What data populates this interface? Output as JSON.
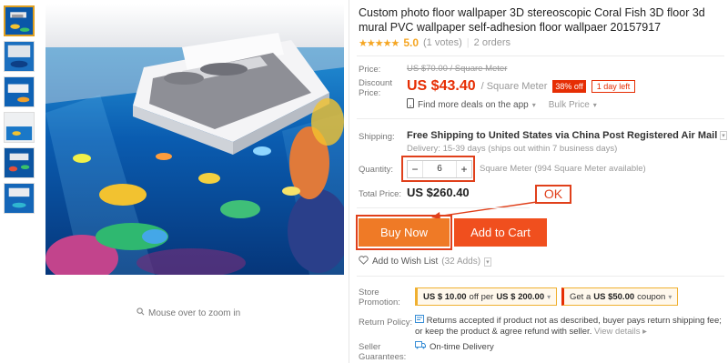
{
  "product": {
    "title": "Custom photo floor wallpaper 3D stereoscopic Coral Fish 3D floor 3d mural PVC wallpaper self-adhesion floor wallpaer 20157917",
    "stars": "★★★★★",
    "rating": "5.0",
    "votes": "(1 votes)",
    "orders": "2 orders"
  },
  "pricing": {
    "price_label": "Price:",
    "original_price": "US $70.00 / Square Meter",
    "discount_label": "Discount Price:",
    "discount_price": "US $43.40",
    "unit": "/ Square Meter",
    "off_badge": "38% off",
    "days_left": "1 day left",
    "app_deals": "Find more deals on the app",
    "bulk_price": "Bulk Price"
  },
  "shipping": {
    "label": "Shipping:",
    "main": "Free Shipping to United States via China Post Registered Air Mail",
    "delivery": "Delivery: 15-39 days (ships out within 7 business days)"
  },
  "quantity": {
    "label": "Quantity:",
    "minus": "−",
    "value": "6",
    "plus": "+",
    "available": "Square Meter (994 Square Meter available)"
  },
  "total": {
    "label": "Total Price:",
    "value": "US $260.40"
  },
  "annotation": {
    "ok": "OK"
  },
  "actions": {
    "buy_now": "Buy Now",
    "add_to_cart": "Add to Cart",
    "wishlist": "Add to Wish List",
    "wishlist_count": "(32 Adds)"
  },
  "promotion": {
    "label": "Store Promotion:",
    "coupon1_prefix": "US $ 10.00",
    "coupon1_mid": "off per",
    "coupon1_suffix": "US $ 200.00",
    "coupon2_prefix": "Get a",
    "coupon2_amount": "US $50.00",
    "coupon2_suffix": "coupon"
  },
  "returns": {
    "label": "Return Policy:",
    "text": "Returns accepted if product not as described, buyer pays return shipping fee; or keep the product & agree refund with seller.",
    "more": "View details ▸"
  },
  "guarantees": {
    "label": "Seller Guarantees:",
    "text": "On-time Delivery"
  },
  "gallery": {
    "zoom_hint": "Mouse over to zoom in"
  },
  "colors": {
    "accent_red": "#e62e04",
    "buy_orange": "#ef7a26",
    "cart_red": "#f04f1e",
    "star_gold": "#f5a623"
  }
}
